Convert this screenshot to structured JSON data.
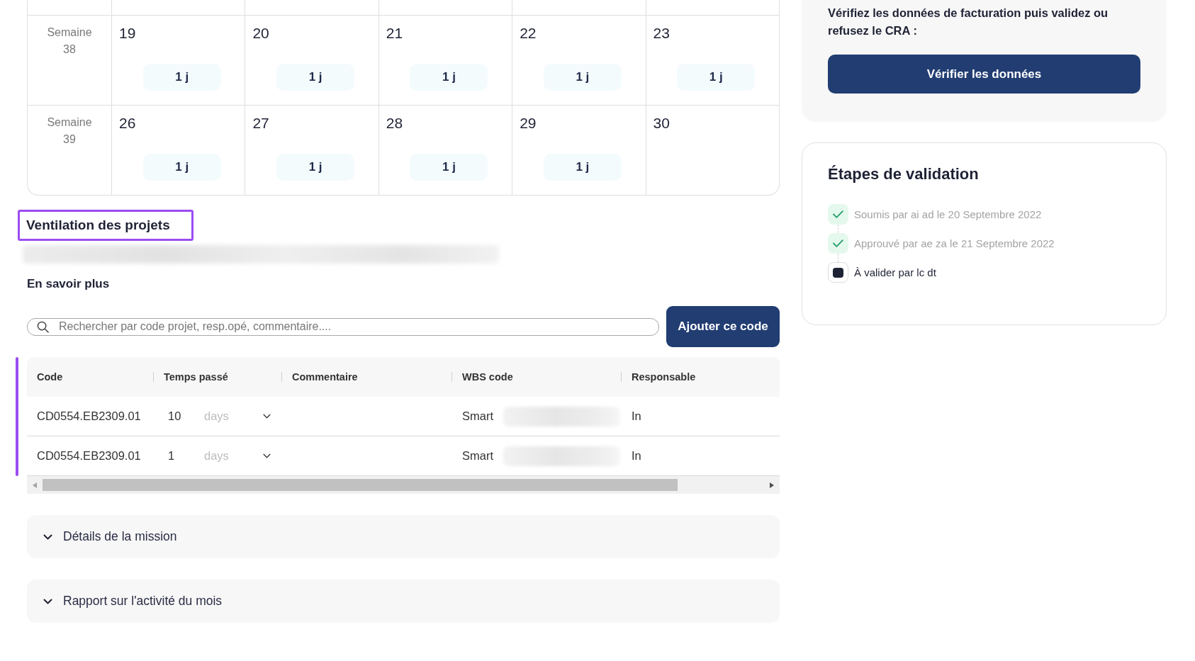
{
  "calendar": {
    "weeks": [
      {
        "label": "Semaine",
        "number": "38",
        "days": [
          {
            "date": "19",
            "time": "1 j"
          },
          {
            "date": "20",
            "time": "1 j"
          },
          {
            "date": "21",
            "time": "1 j"
          },
          {
            "date": "22",
            "time": "1 j"
          },
          {
            "date": "23",
            "time": "1 j"
          }
        ]
      },
      {
        "label": "Semaine",
        "number": "39",
        "days": [
          {
            "date": "26",
            "time": "1 j"
          },
          {
            "date": "27",
            "time": "1 j"
          },
          {
            "date": "28",
            "time": "1 j"
          },
          {
            "date": "29",
            "time": "1 j"
          },
          {
            "date": "30"
          }
        ]
      }
    ]
  },
  "projects": {
    "title": "Ventilation des projets",
    "title_highlighted": true,
    "learn_more": "En savoir plus",
    "search": {
      "placeholder": "Rechercher par code projet, resp.opé, commentaire...."
    },
    "add_button": "Ajouter ce code",
    "table": {
      "highlighted": true,
      "columns": [
        "Code",
        "Temps passé",
        "Commentaire",
        "WBS code",
        "Responsable"
      ],
      "rows": [
        {
          "code": "CD0554.EB2309.01",
          "time": "10",
          "unit": "days",
          "wbs": "Smart",
          "responsable": "In"
        },
        {
          "code": "CD0554.EB2309.01",
          "time": "1",
          "unit": "days",
          "wbs": "Smart",
          "responsable": "In"
        }
      ]
    }
  },
  "sections": [
    {
      "title": "Détails de la mission",
      "expanded": false
    },
    {
      "title": "Rapport sur l'activité du mois",
      "expanded": false
    }
  ],
  "billing": {
    "text": "Vérifiez les données de facturation puis validez ou refusez le CRA :",
    "button": "Vérifier les données"
  },
  "validation": {
    "title": "Étapes de validation",
    "steps": [
      {
        "text": "Soumis par ai ad le 20 Septembre 2022",
        "done": true
      },
      {
        "text": "Approuvé par ae za le 21 Septembre 2022",
        "done": true
      },
      {
        "text": "À valider par lc dt",
        "done": false
      }
    ]
  }
}
